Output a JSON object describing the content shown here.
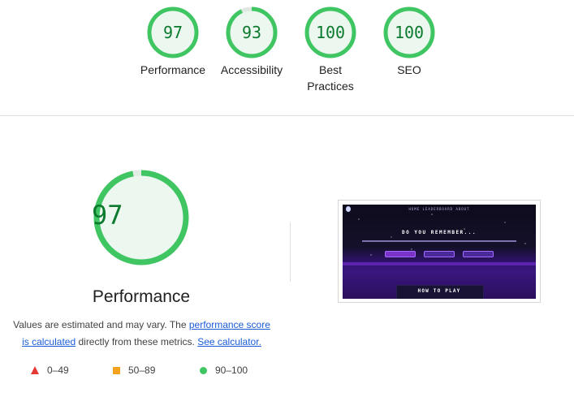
{
  "summary": {
    "gauges": [
      {
        "score": "97",
        "label": "Performance"
      },
      {
        "score": "93",
        "label": "Accessibility"
      },
      {
        "score": "100",
        "label": "Best Practices"
      },
      {
        "score": "100",
        "label": "SEO"
      }
    ]
  },
  "performance": {
    "score": "97",
    "score_fraction": 0.97,
    "title": "Performance",
    "description": {
      "prefix": "Values are estimated and may vary. The ",
      "link1": "performance score is calculated",
      "middle": " directly from these metrics. ",
      "link2": "See calculator."
    },
    "legend": [
      {
        "shape": "triangle",
        "range": "0–49",
        "color": "#e53935"
      },
      {
        "shape": "square",
        "range": "50–89",
        "color": "#f4a21d"
      },
      {
        "shape": "circle",
        "range": "90–100",
        "color": "#3fc561"
      }
    ]
  },
  "screenshot": {
    "heading": "DO YOU REMEMBER...",
    "subheading": "HOW TO PLAY",
    "nav": "HOME  LEADERBOARD  ABOUT"
  },
  "colors": {
    "pass_green": "#3fc561",
    "pass_fill": "#ebf7ef",
    "score_text": "#0b7a2e",
    "link": "#1a5cd8"
  }
}
